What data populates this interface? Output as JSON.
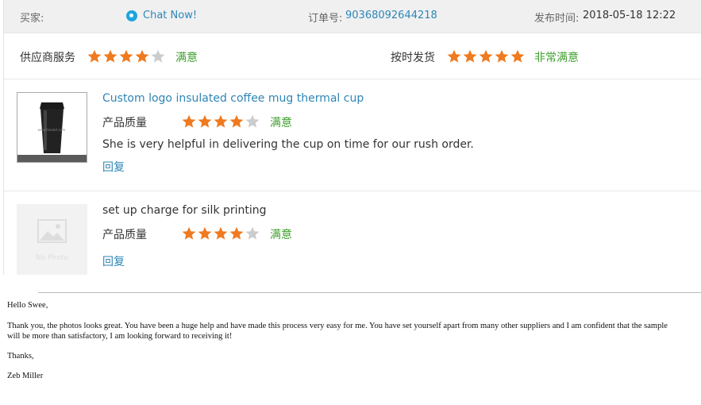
{
  "header": {
    "buyer_label": "买家:",
    "chat_label": "Chat Now!",
    "order_label": "订单号:",
    "order_number": "90368092644218",
    "date_label": "发布时间:",
    "date_value": "2018-05-18 12:22"
  },
  "ratings": {
    "supplier_service": {
      "label": "供应商服务",
      "stars": 4,
      "max": 5,
      "text": "满意"
    },
    "on_time_delivery": {
      "label": "按时发货",
      "stars": 5,
      "max": 5,
      "text": "非常满意"
    }
  },
  "reviews": [
    {
      "product_title": "Custom logo insulated coffee mug thermal cup",
      "quality_label": "产品质量",
      "stars": 4,
      "max": 5,
      "rating_text": "满意",
      "comment": "She is very helpful in delivering the cup on time for our rush order.",
      "reply_label": "回复",
      "thumb_text": "www.hiveart.com"
    },
    {
      "product_title": "set up charge for silk printing",
      "quality_label": "产品质量",
      "stars": 4,
      "max": 5,
      "rating_text": "满意",
      "reply_label": "回复",
      "thumb_text": "No Photo"
    }
  ],
  "email": {
    "greeting": "Hello Swee,",
    "body_line1": "Thank you, the photos looks great. You have been a huge help and have made this process very easy for me. You have set yourself apart from many other suppliers and I am confident that the sample",
    "body_line2": "will be more than satisfactory, I am looking forward to receiving it!",
    "closing": "Thanks,",
    "signature": "Zeb Miller"
  },
  "colors": {
    "star_on": "#f07a1f",
    "star_off": "#cccccc",
    "link": "#2e86b6",
    "satisfied": "#3f9f2e"
  }
}
